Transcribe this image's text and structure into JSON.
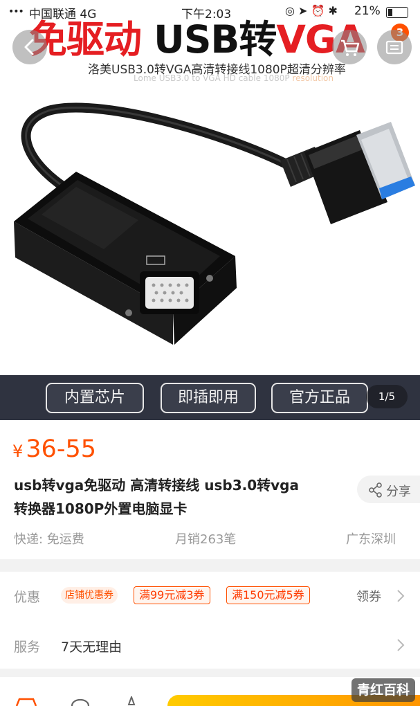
{
  "status_bar": {
    "signal": "•••",
    "carrier": "中国联通  4G",
    "time": "下午2:03",
    "icons": "◎ ➤ ⏰ ✱",
    "battery": "21%"
  },
  "hero": {
    "title_red": "免驱动 ",
    "title_black": "USB转",
    "title_tail": "VGA",
    "subtitle": "洛美USB3.0转VGA高清转接线1080P超清分辨率",
    "subtitle_en": "Lome USB3.0 to VGA HD cable 1080P ",
    "subtitle_en_tail": "resolution",
    "cart_count": "3",
    "features": [
      "内置芯片",
      "即插即用",
      "官方正品"
    ],
    "pager": "1/5"
  },
  "product": {
    "price_symbol": "¥",
    "price": "36-55",
    "title_line1": "usb转vga免驱动 高清转接线 usb3.0转vga",
    "title_line2": "转换器1080P外置电脑显卡",
    "share_label": "分享",
    "shipping": "快递: 免运费",
    "monthly_sales": "月销263笔",
    "location": "广东深圳"
  },
  "promo": {
    "label": "优惠",
    "shop_coupon": "店铺优惠券",
    "coupons": [
      "满99元减3券",
      "满150元减5券"
    ],
    "get_coupon": "领券"
  },
  "service": {
    "label": "服务",
    "text": "7天无理由"
  },
  "watermark": "青红百科",
  "colors": {
    "accent": "#ff5000",
    "hero_red": "#e51e22",
    "strip": "#2f3340"
  },
  "icons": [
    "back-icon",
    "cart-icon",
    "more-icon",
    "share-icon",
    "chevron-right-icon",
    "shop-icon",
    "service-icon",
    "favorite-icon"
  ]
}
